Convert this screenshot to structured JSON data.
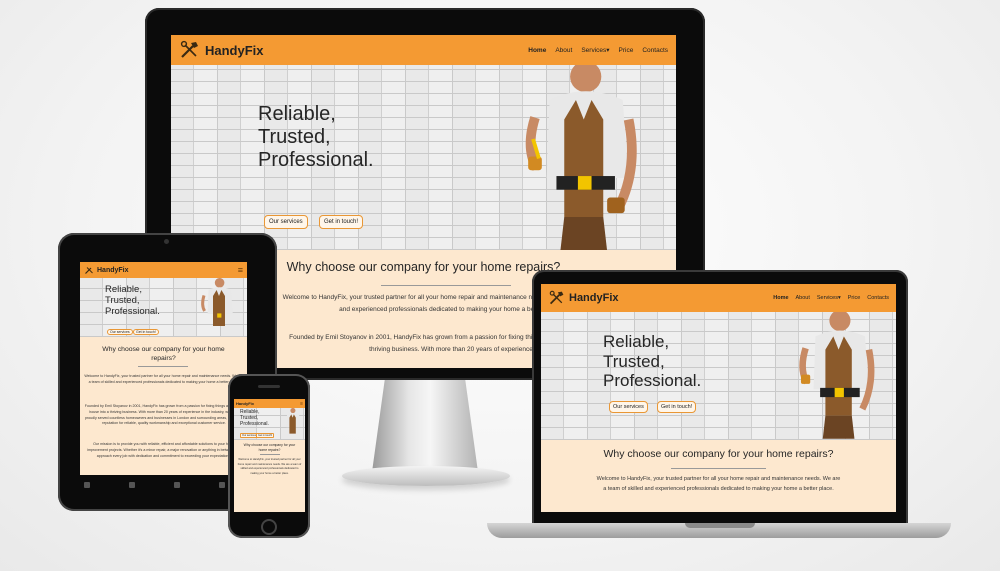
{
  "site": {
    "brand": "HandyFix",
    "nav": {
      "home": "Home",
      "about": "About",
      "services": "Services",
      "price": "Price",
      "contacts": "Contacts",
      "services_caret": "▾"
    },
    "hero": {
      "line1": "Reliable,",
      "line2": "Trusted,",
      "line3": "Professional.",
      "btn_services": "Our services",
      "btn_contact": "Get in touch!"
    },
    "why": {
      "title": "Why choose our company for your home repairs?",
      "p1": "Welcome to HandyFix, your trusted partner for all your home repair and maintenance needs. We are a team of skilled and experienced professionals dedicated to making your home a better place.",
      "p2": "Founded by Emil Stoyanov in 2001, HandyFix has grown from a passion for fixing things around the house into a thriving business. With more than 20 years of experience in the industry, we have proudly served countless homeowners and businesses in London and surrounding areas, earning a reputation for reliable, quality workmanship and exceptional customer service.",
      "p3": "Our mission is to provide you with reliable, efficient and affordable solutions to your home improvement projects. Whether it's a minor repair, a major renovation or anything in between, we approach every job with dedication and commitment to exceeding your expectations."
    },
    "monitor_p1": "Welcome to HandyFix, your trusted partner for all your home repair and maintenance needs. We are a team of skilled and experienced professionals dedicated to making your home a better place.",
    "monitor_p2": "Founded by Emil Stoyanov in 2001, HandyFix has grown from a passion for fixing things around the house into a thriving business. With more than 20 years of experience",
    "hamburger": "≡"
  },
  "colors": {
    "nav": "#f49a33",
    "page_bg": "#fde8cf",
    "button_border": "#e99735"
  }
}
